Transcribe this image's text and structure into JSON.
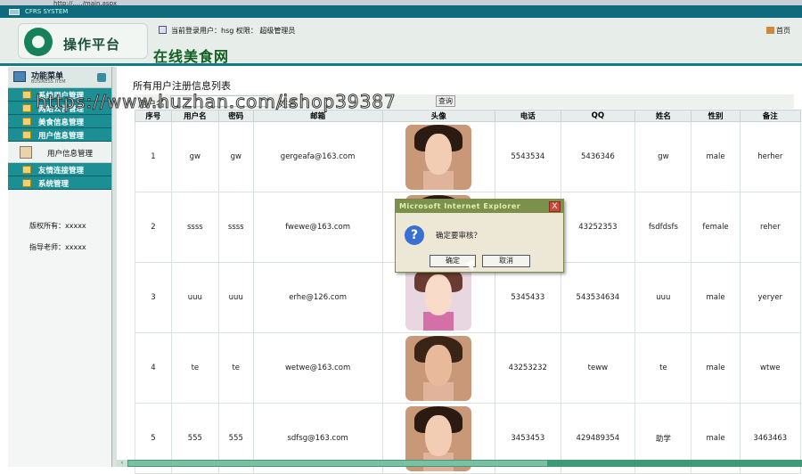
{
  "browser": {
    "url": "http://...../main.aspx",
    "window_title": "CFRS SYSTEM"
  },
  "header": {
    "logo_text": "操作平台",
    "site_name": "在线美食网",
    "user_info": "当前登录用户：hsg 权限： 超级管理员",
    "home_link": "首页"
  },
  "sidebar": {
    "title": "功能菜单",
    "title_sub": "BUSINESS ITEM",
    "menus": [
      {
        "label": "系统用户管理"
      },
      {
        "label": "网站公告管理"
      },
      {
        "label": "美食信息管理"
      },
      {
        "label": "用户信息管理"
      }
    ],
    "subitem": {
      "label": "用户信息管理"
    },
    "menus2": [
      {
        "label": "友情连接管理"
      },
      {
        "label": "系统管理"
      }
    ],
    "credits": {
      "copyright": "版权所有：xxxxx",
      "teacher": "指导老师：xxxxx"
    }
  },
  "content": {
    "title": "所有用户注册信息列表",
    "search": {
      "label_user": "用户名",
      "label_name": "姓名",
      "button": "查询"
    },
    "columns": [
      "序号",
      "用户名",
      "密码",
      "邮箱",
      "头像",
      "电话",
      "QQ",
      "姓名",
      "性别",
      "备注"
    ],
    "rows": [
      {
        "id": "1",
        "username": "gw",
        "password": "gw",
        "email": "gergeafa@163.com",
        "phone": "5543534",
        "qq": "5436346",
        "name": "gw",
        "gender": "male",
        "note": "herher"
      },
      {
        "id": "2",
        "username": "ssss",
        "password": "ssss",
        "email": "fwewe@163.com",
        "phone": "",
        "qq": "43252353",
        "name": "fsdfdsfs",
        "gender": "female",
        "note": "reher"
      },
      {
        "id": "3",
        "username": "uuu",
        "password": "uuu",
        "email": "erhe@126.com",
        "phone": "5345433",
        "qq": "543534634",
        "name": "uuu",
        "gender": "male",
        "note": "yeryer"
      },
      {
        "id": "4",
        "username": "te",
        "password": "te",
        "email": "wetwe@163.com",
        "phone": "43253232",
        "qq": "teww",
        "name": "te",
        "gender": "male",
        "note": "wtwe"
      },
      {
        "id": "5",
        "username": "555",
        "password": "555",
        "email": "sdfsg@163.com",
        "phone": "3453453",
        "qq": "429489354",
        "name": "助学",
        "gender": "male",
        "note": "3463463"
      }
    ]
  },
  "dialog": {
    "title": "Microsoft Internet Explorer",
    "message": "确定要审核？",
    "ok": "确定",
    "cancel": "取消",
    "close": "X"
  },
  "watermark": "https://www.huzhan.com/ishop39387"
}
